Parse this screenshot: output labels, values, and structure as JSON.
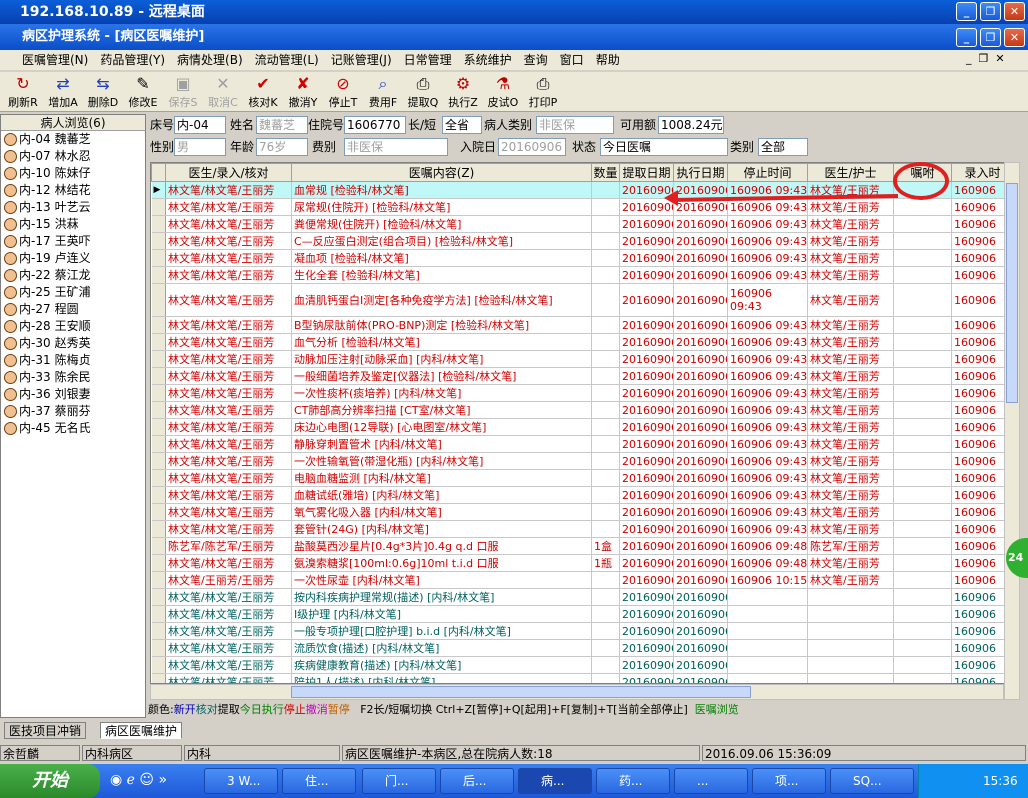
{
  "rdp": {
    "title": "192.168.10.89 - 远程桌面",
    "min": "_",
    "max": "❐",
    "close": "✕"
  },
  "app": {
    "title": "病区护理系统 - [病区医嘱维护]",
    "min": "_",
    "max": "❐",
    "close": "✕",
    "mdi_min": "_",
    "mdi_max": "❐",
    "mdi_close": "✕"
  },
  "menu": [
    "医嘱管理(N)",
    "药品管理(Y)",
    "病情处理(B)",
    "流动管理(L)",
    "记账管理(J)",
    "日常管理",
    "系统维护",
    "查询",
    "窗口",
    "帮助"
  ],
  "toolbar": [
    {
      "label": "刷新R",
      "icon": "↻",
      "color": "#c00000",
      "disabled": false
    },
    {
      "label": "增加A",
      "icon": "⇄",
      "color": "#2040c0",
      "disabled": false
    },
    {
      "label": "删除D",
      "icon": "⇆",
      "color": "#2040c0",
      "disabled": false
    },
    {
      "label": "修改E",
      "icon": "✎",
      "color": "#000000",
      "disabled": false
    },
    {
      "label": "保存S",
      "icon": "▣",
      "color": "#a0a0a0",
      "disabled": true
    },
    {
      "label": "取消C",
      "icon": "✕",
      "color": "#a0a0a0",
      "disabled": true
    },
    {
      "label": "核对K",
      "icon": "✔",
      "color": "#d00000",
      "disabled": false
    },
    {
      "label": "撤消Y",
      "icon": "✘",
      "color": "#d00000",
      "disabled": false
    },
    {
      "label": "停止T",
      "icon": "⊘",
      "color": "#d00000",
      "disabled": false
    },
    {
      "label": "费用F",
      "icon": "⌕",
      "color": "#2040c0",
      "disabled": false
    },
    {
      "label": "提取Q",
      "icon": "⎙",
      "color": "#000000",
      "disabled": false
    },
    {
      "label": "执行Z",
      "icon": "⚙",
      "color": "#c00000",
      "disabled": false
    },
    {
      "label": "皮试O",
      "icon": "⚗",
      "color": "#c00000",
      "disabled": false
    },
    {
      "label": "打印P",
      "icon": "⎙",
      "color": "#000000",
      "disabled": false
    }
  ],
  "patients": {
    "header": "病人浏览(6)",
    "list": [
      {
        "bed": "内-04",
        "name": "魏蕃芝"
      },
      {
        "bed": "内-07",
        "name": "林水忍"
      },
      {
        "bed": "内-10",
        "name": "陈妹仔"
      },
      {
        "bed": "内-12",
        "name": "林结花"
      },
      {
        "bed": "内-13",
        "name": "叶艺云"
      },
      {
        "bed": "内-15",
        "name": "洪菻"
      },
      {
        "bed": "内-17",
        "name": "王英吓"
      },
      {
        "bed": "内-19",
        "name": "卢连义"
      },
      {
        "bed": "内-22",
        "name": "蔡江龙"
      },
      {
        "bed": "内-25",
        "name": "王矿浦"
      },
      {
        "bed": "内-27",
        "name": "程圆"
      },
      {
        "bed": "内-28",
        "name": "王安顺"
      },
      {
        "bed": "内-30",
        "name": "赵秀英"
      },
      {
        "bed": "内-31",
        "name": "陈梅贞"
      },
      {
        "bed": "内-33",
        "name": "陈余民"
      },
      {
        "bed": "内-36",
        "name": "刘银妻"
      },
      {
        "bed": "内-37",
        "name": "蔡丽芬"
      },
      {
        "bed": "内-45",
        "name": "无名氏"
      }
    ]
  },
  "form": {
    "bed_label": "床号",
    "bed": "内-04",
    "name_label": "姓名",
    "name": "魏蕃芝",
    "admit_no_label": "住院号",
    "admit_no": "1606770",
    "long_short_label": "长/短",
    "long_short": "全省",
    "patient_type_label": "病人类别",
    "patient_type": "非医保",
    "balance_label": "可用额",
    "balance": "1008.24元",
    "sex_label": "性别",
    "sex": "男",
    "age_label": "年龄",
    "age": "76岁",
    "fee_label": "费别",
    "fee": "非医保",
    "in_date_label": "入院日",
    "in_date": "20160906",
    "status_label": "状态",
    "status": "今日医嘱",
    "category_label": "类别",
    "category": "全部"
  },
  "grid": {
    "headers": [
      "医生/录入/核对",
      "医嘱内容(Z)",
      "数量",
      "提取日期",
      "执行日期",
      "停止时间",
      "医生/护士",
      "嘱咐",
      "录入时"
    ],
    "rows": [
      {
        "c": "red",
        "doc": "林文笔/林文笔/王丽芳",
        "content": "血常规  [检验科/林文笔]",
        "qty": "",
        "fetch": "20160906",
        "exec": "20160906",
        "stop": "160906 09:43",
        "nurse": "林文笔/王丽芳",
        "note": "",
        "entry": "160906"
      },
      {
        "c": "red",
        "doc": "林文笔/林文笔/王丽芳",
        "content": "尿常规(住院开)  [检验科/林文笔]",
        "qty": "",
        "fetch": "20160906",
        "exec": "20160906",
        "stop": "160906 09:43",
        "nurse": "林文笔/王丽芳",
        "note": "",
        "entry": "160906"
      },
      {
        "c": "red",
        "doc": "林文笔/林文笔/王丽芳",
        "content": "粪便常规(住院开)  [检验科/林文笔]",
        "qty": "",
        "fetch": "20160906",
        "exec": "20160906",
        "stop": "160906 09:43",
        "nurse": "林文笔/王丽芳",
        "note": "",
        "entry": "160906"
      },
      {
        "c": "red",
        "doc": "林文笔/林文笔/王丽芳",
        "content": "C—反应蛋白测定(组合项目)  [检验科/林文笔]",
        "qty": "",
        "fetch": "20160906",
        "exec": "20160906",
        "stop": "160906 09:43",
        "nurse": "林文笔/王丽芳",
        "note": "",
        "entry": "160906"
      },
      {
        "c": "red",
        "doc": "林文笔/林文笔/王丽芳",
        "content": "凝血项  [检验科/林文笔]",
        "qty": "",
        "fetch": "20160906",
        "exec": "20160906",
        "stop": "160906 09:43",
        "nurse": "林文笔/王丽芳",
        "note": "",
        "entry": "160906"
      },
      {
        "c": "red",
        "doc": "林文笔/林文笔/王丽芳",
        "content": "生化全套  [检验科/林文笔]",
        "qty": "",
        "fetch": "20160906",
        "exec": "20160906",
        "stop": "160906 09:43",
        "nurse": "林文笔/王丽芳",
        "note": "",
        "entry": "160906"
      },
      {
        "c": "red tall",
        "doc": "林文笔/林文笔/王丽芳",
        "content": "血清肌钙蛋白Ⅰ测定[各种免疫学方法]  [检验科/林文笔]",
        "qty": "",
        "fetch": "20160906",
        "exec": "20160906",
        "stop": "160906 09:43",
        "nurse": "林文笔/王丽芳",
        "note": "",
        "entry": "160906"
      },
      {
        "c": "red",
        "doc": "林文笔/林文笔/王丽芳",
        "content": "B型钠尿肽前体(PRO-BNP)测定  [检验科/林文笔]",
        "qty": "",
        "fetch": "20160906",
        "exec": "20160906",
        "stop": "160906 09:43",
        "nurse": "林文笔/王丽芳",
        "note": "",
        "entry": "160906"
      },
      {
        "c": "red",
        "doc": "林文笔/林文笔/王丽芳",
        "content": "血气分析  [检验科/林文笔]",
        "qty": "",
        "fetch": "20160906",
        "exec": "20160906",
        "stop": "160906 09:43",
        "nurse": "林文笔/王丽芳",
        "note": "",
        "entry": "160906"
      },
      {
        "c": "red",
        "doc": "林文笔/林文笔/王丽芳",
        "content": "动脉加压注射[动脉采血]  [内科/林文笔]",
        "qty": "",
        "fetch": "20160906",
        "exec": "20160906",
        "stop": "160906 09:43",
        "nurse": "林文笔/王丽芳",
        "note": "",
        "entry": "160906"
      },
      {
        "c": "red",
        "doc": "林文笔/林文笔/王丽芳",
        "content": "一般细菌培养及鉴定[仪器法]  [检验科/林文笔]",
        "qty": "",
        "fetch": "20160906",
        "exec": "20160906",
        "stop": "160906 09:43",
        "nurse": "林文笔/王丽芳",
        "note": "",
        "entry": "160906"
      },
      {
        "c": "red",
        "doc": "林文笔/林文笔/王丽芳",
        "content": "一次性痰杯(痰培养)  [内科/林文笔]",
        "qty": "",
        "fetch": "20160906",
        "exec": "20160906",
        "stop": "160906 09:43",
        "nurse": "林文笔/王丽芳",
        "note": "",
        "entry": "160906"
      },
      {
        "c": "red",
        "doc": "林文笔/林文笔/王丽芳",
        "content": "CT肺部高分辨率扫描  [CT室/林文笔]",
        "qty": "",
        "fetch": "20160906",
        "exec": "20160906",
        "stop": "160906 09:43",
        "nurse": "林文笔/王丽芳",
        "note": "",
        "entry": "160906"
      },
      {
        "c": "red",
        "doc": "林文笔/林文笔/王丽芳",
        "content": "床边心电图(12导联)  [心电图室/林文笔]",
        "qty": "",
        "fetch": "20160906",
        "exec": "20160906",
        "stop": "160906 09:43",
        "nurse": "林文笔/王丽芳",
        "note": "",
        "entry": "160906"
      },
      {
        "c": "red",
        "doc": "林文笔/林文笔/王丽芳",
        "content": "静脉穿刺置管术  [内科/林文笔]",
        "qty": "",
        "fetch": "20160906",
        "exec": "20160906",
        "stop": "160906 09:43",
        "nurse": "林文笔/王丽芳",
        "note": "",
        "entry": "160906"
      },
      {
        "c": "red",
        "doc": "林文笔/林文笔/王丽芳",
        "content": "一次性输氧管(带湿化瓶)  [内科/林文笔]",
        "qty": "",
        "fetch": "20160906",
        "exec": "20160906",
        "stop": "160906 09:43",
        "nurse": "林文笔/王丽芳",
        "note": "",
        "entry": "160906"
      },
      {
        "c": "red",
        "doc": "林文笔/林文笔/王丽芳",
        "content": "电脑血糖监测  [内科/林文笔]",
        "qty": "",
        "fetch": "20160906",
        "exec": "20160906",
        "stop": "160906 09:43",
        "nurse": "林文笔/王丽芳",
        "note": "",
        "entry": "160906"
      },
      {
        "c": "red",
        "doc": "林文笔/林文笔/王丽芳",
        "content": "血糖试纸(雅培)  [内科/林文笔]",
        "qty": "",
        "fetch": "20160906",
        "exec": "20160906",
        "stop": "160906 09:43",
        "nurse": "林文笔/王丽芳",
        "note": "",
        "entry": "160906"
      },
      {
        "c": "red",
        "doc": "林文笔/林文笔/王丽芳",
        "content": "氧气雾化吸入器  [内科/林文笔]",
        "qty": "",
        "fetch": "20160906",
        "exec": "20160906",
        "stop": "160906 09:43",
        "nurse": "林文笔/王丽芳",
        "note": "",
        "entry": "160906"
      },
      {
        "c": "red",
        "doc": "林文笔/林文笔/王丽芳",
        "content": "套管针(24G)  [内科/林文笔]",
        "qty": "",
        "fetch": "20160906",
        "exec": "20160906",
        "stop": "160906 09:43",
        "nurse": "林文笔/王丽芳",
        "note": "",
        "entry": "160906"
      },
      {
        "c": "red",
        "doc": "陈艺军/陈艺军/王丽芳",
        "content": "盐酸莫西沙星片[0.4g*3片]0.4g q.d 口服",
        "qty": "1盒",
        "fetch": "20160906",
        "exec": "20160906",
        "stop": "160906 09:48",
        "nurse": "陈艺军/王丽芳",
        "note": "",
        "entry": "160906"
      },
      {
        "c": "red",
        "doc": "林文笔/林文笔/王丽芳",
        "content": "氨溴索糖浆[100ml:0.6g]10ml t.i.d 口服",
        "qty": "1瓶",
        "fetch": "20160906",
        "exec": "20160906",
        "stop": "160906 09:48",
        "nurse": "林文笔/王丽芳",
        "note": "",
        "entry": "160906"
      },
      {
        "c": "red",
        "doc": "林文笔/王丽芳/王丽芳",
        "content": "一次性尿壶  [内科/林文笔]",
        "qty": "",
        "fetch": "20160906",
        "exec": "20160906",
        "stop": "160906 10:15",
        "nurse": "林文笔/王丽芳",
        "note": "",
        "entry": "160906"
      },
      {
        "c": "grn",
        "doc": "林文笔/林文笔/王丽芳",
        "content": "按内科疾病护理常规(描述)  [内科/林文笔]",
        "qty": "",
        "fetch": "20160906",
        "exec": "20160906",
        "stop": "",
        "nurse": "",
        "note": "",
        "entry": "160906"
      },
      {
        "c": "grn",
        "doc": "林文笔/林文笔/王丽芳",
        "content": "Ⅰ级护理  [内科/林文笔]",
        "qty": "",
        "fetch": "20160906",
        "exec": "20160906",
        "stop": "",
        "nurse": "",
        "note": "",
        "entry": "160906"
      },
      {
        "c": "grn",
        "doc": "林文笔/林文笔/王丽芳",
        "content": "一般专项护理[口腔护理] b.i.d  [内科/林文笔]",
        "qty": "",
        "fetch": "20160906",
        "exec": "20160906",
        "stop": "",
        "nurse": "",
        "note": "",
        "entry": "160906"
      },
      {
        "c": "grn",
        "doc": "林文笔/林文笔/王丽芳",
        "content": "流质饮食(描述)  [内科/林文笔]",
        "qty": "",
        "fetch": "20160906",
        "exec": "20160906",
        "stop": "",
        "nurse": "",
        "note": "",
        "entry": "160906"
      },
      {
        "c": "grn",
        "doc": "林文笔/林文笔/王丽芳",
        "content": "疾病健康教育(描述)  [内科/林文笔]",
        "qty": "",
        "fetch": "20160906",
        "exec": "20160906",
        "stop": "",
        "nurse": "",
        "note": "",
        "entry": "160906"
      },
      {
        "c": "grn",
        "doc": "林文笔/林文笔/王丽芳",
        "content": "陪护1人(描述)  [内科/林文笔]",
        "qty": "",
        "fetch": "20160906",
        "exec": "20160906",
        "stop": "",
        "nurse": "",
        "note": "",
        "entry": "160906"
      }
    ]
  },
  "legend": {
    "prefix": "颜色:",
    "new": "新开",
    "check": "核对",
    "fetch": "提取",
    "today": "今日执行",
    "stop": "停止",
    "undo": "撤消",
    "pause": "暂停",
    "shortcuts": "F2长/短嘱切换   Ctrl+Z[暂停]+Q[起用]+F[复制]+T[当前全部停止]",
    "browse": "医嘱浏览",
    "colors": {
      "new": "#0000c0",
      "check": "#006060",
      "fetch": "#000000",
      "today": "#008000",
      "stop": "#d00000",
      "undo": "#c000c0",
      "pause": "#c06000"
    }
  },
  "tabs": [
    "医技项目冲销",
    "病区医嘱维护"
  ],
  "status": {
    "user": "余哲麟",
    "ward": "内科病区",
    "dept": "内科",
    "msg": "病区医嘱维护-本病区,总在院病人数:18",
    "datetime": "2016.09.06 15:36:09"
  },
  "taskbar": {
    "start": "开始",
    "items": [
      "3 W...",
      "住...",
      "门...",
      "后...",
      "病...",
      "药...",
      "...",
      "项...",
      "SQ..."
    ],
    "time": "15:36"
  },
  "bubble": "24"
}
